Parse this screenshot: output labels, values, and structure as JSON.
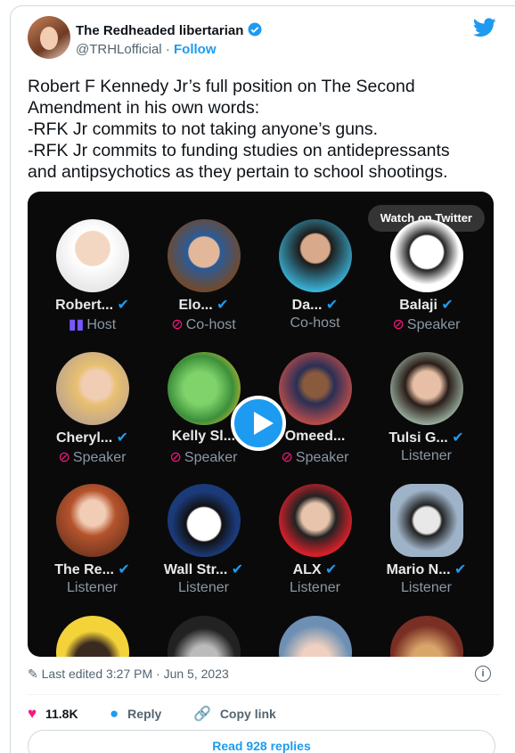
{
  "author": {
    "name": "The Redheaded libertarian",
    "handle": "@TRHLofficial",
    "separator": "·",
    "follow_label": "Follow"
  },
  "tweet_text": "Robert F Kennedy Jr’s full position on The Second\nAmendment in his own words:\n-RFK Jr commits to not taking anyone’s guns.\n-RFK Jr commits to funding studies on antidepressants\nand antipsychotics as they pertain to school shootings.",
  "media": {
    "watch_label": "Watch on Twitter",
    "speakers": [
      {
        "name": "Robert...",
        "role": "Host",
        "role_icon": "bars-icon",
        "verified": true
      },
      {
        "name": "Elo...",
        "role": "Co-host",
        "role_icon": "muted-mic-icon",
        "verified": true
      },
      {
        "name": "Da...",
        "role": "Co-host",
        "role_icon": "none",
        "verified": true
      },
      {
        "name": "Balaji",
        "role": "Speaker",
        "role_icon": "muted-mic-icon",
        "verified": true
      },
      {
        "name": "Cheryl...",
        "role": "Speaker",
        "role_icon": "muted-mic-icon",
        "verified": true
      },
      {
        "name": "Kelly Sl...",
        "role": "Speaker",
        "role_icon": "muted-mic-icon",
        "verified": false
      },
      {
        "name": "Omeed...",
        "role": "Speaker",
        "role_icon": "muted-mic-icon",
        "verified": false
      },
      {
        "name": "Tulsi G...",
        "role": "Listener",
        "role_icon": "none",
        "verified": true
      },
      {
        "name": "The Re...",
        "role": "Listener",
        "role_icon": "none",
        "verified": true
      },
      {
        "name": "Wall Str...",
        "role": "Listener",
        "role_icon": "none",
        "verified": true
      },
      {
        "name": "ALX",
        "role": "Listener",
        "role_icon": "none",
        "verified": true
      },
      {
        "name": "Mario N...",
        "role": "Listener",
        "role_icon": "none",
        "verified": true
      }
    ]
  },
  "edited": "Last edited 3:27 PM · Jun 5, 2023",
  "actions": {
    "likes": "11.8K",
    "reply": "Reply",
    "copy_link": "Copy link"
  },
  "read_replies": "Read 928 replies",
  "colors": {
    "accent": "#1d9bf0",
    "like": "#f91880",
    "verified": "#1d9bf0"
  }
}
